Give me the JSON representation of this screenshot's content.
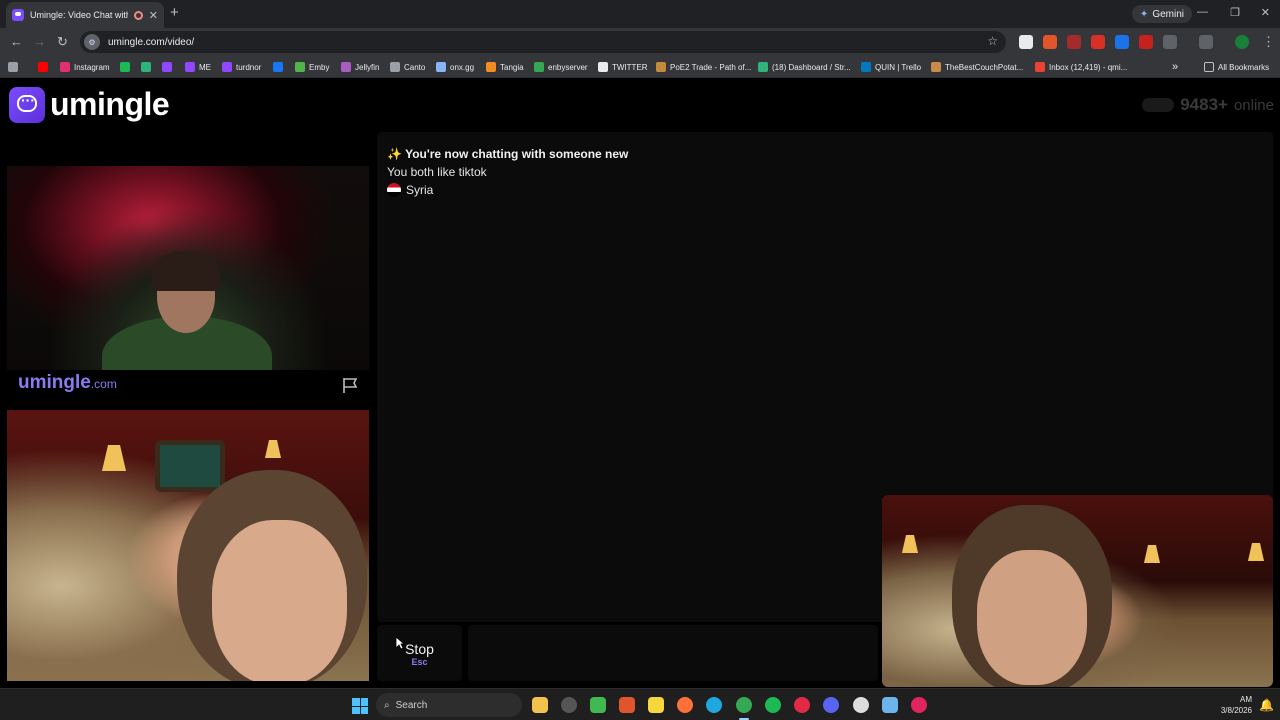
{
  "browser": {
    "tab_title": "Umingle: Video Chat with S",
    "new_tab": "+",
    "tab_close": "✕",
    "gemini_label": "Gemini",
    "url": "umingle.com/video/",
    "window_controls": {
      "minimize": "—",
      "maximize": "❐",
      "close": "✕"
    },
    "bookmarks": [
      {
        "label": "",
        "icon": "youtube-icon",
        "color": "#ff0000"
      },
      {
        "label": "Instagram",
        "icon": "instagram-icon",
        "color": "#e1306c"
      },
      {
        "label": "",
        "icon": "spotify-icon",
        "color": "#1db954"
      },
      {
        "label": "",
        "icon": "bookmark-icon",
        "color": "#2fb37a"
      },
      {
        "label": "",
        "icon": "twitch-icon",
        "color": "#9146ff"
      },
      {
        "label": "ME",
        "icon": "twitch-icon",
        "color": "#9146ff"
      },
      {
        "label": "turdnor",
        "icon": "twitch-icon",
        "color": "#9146ff"
      },
      {
        "label": "",
        "icon": "facebook-icon",
        "color": "#1877f2"
      },
      {
        "label": "Emby",
        "icon": "emby-icon",
        "color": "#52b54b"
      },
      {
        "label": "Jellyfin",
        "icon": "jellyfin-icon",
        "color": "#aa5cc3"
      },
      {
        "label": "Canto",
        "icon": "canto-icon",
        "color": "#9aa0a6"
      },
      {
        "label": "onx.gg",
        "icon": "onx-icon",
        "color": "#8ab4f8"
      },
      {
        "label": "Tangia",
        "icon": "tangia-icon",
        "color": "#f28b24"
      },
      {
        "label": "enbyserver",
        "icon": "server-icon",
        "color": "#34a853"
      },
      {
        "label": "TWITTER",
        "icon": "x-icon",
        "color": "#e8eaed"
      },
      {
        "label": "PoE2 Trade - Path of...",
        "icon": "poe-icon",
        "color": "#c58b3c"
      },
      {
        "label": "(18) Dashboard / Str...",
        "icon": "dashboard-icon",
        "color": "#2fb37a"
      },
      {
        "label": "QUIN | Trello",
        "icon": "trello-icon",
        "color": "#0079bf"
      },
      {
        "label": "TheBestCouchPotat...",
        "icon": "couch-icon",
        "color": "#c98a4a"
      },
      {
        "label": "Inbox (12,419) - qmi...",
        "icon": "gmail-icon",
        "color": "#ea4335"
      }
    ],
    "more_bookmarks": "»",
    "all_bookmarks": "All Bookmarks"
  },
  "page": {
    "logo_text": "umingle",
    "online_count": "9483+",
    "online_label": "online",
    "watermark_brand": "umingle",
    "watermark_domain": ".com",
    "chat": {
      "system_icon": "✨",
      "system_message": "You're now chatting with someone new",
      "common_interest": "You both like tiktok",
      "country": "Syria"
    },
    "stop_label": "Stop",
    "stop_key": "Esc",
    "message_placeholder": ""
  },
  "taskbar": {
    "search_label": "Search",
    "time": "AM",
    "date": "3/8/2026",
    "accent": "#4cc2ff"
  }
}
